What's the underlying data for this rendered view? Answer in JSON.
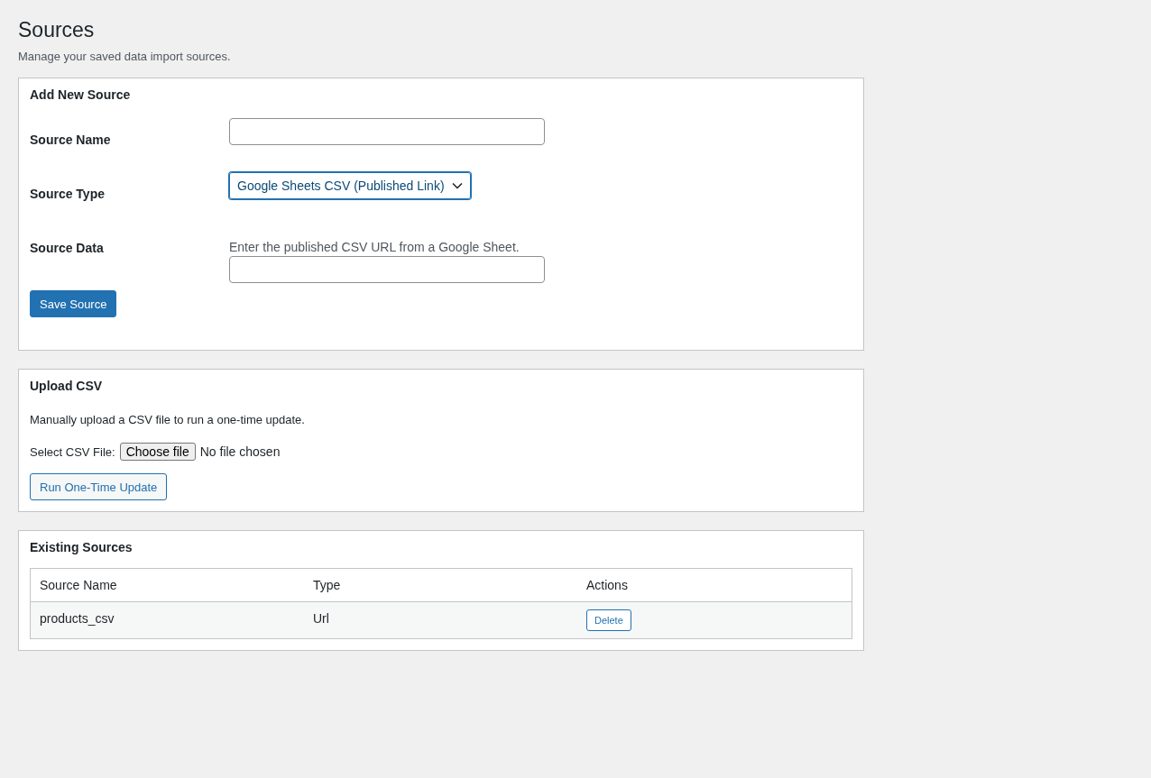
{
  "page": {
    "title": "Sources",
    "description": "Manage your saved data import sources."
  },
  "add_source": {
    "title": "Add New Source",
    "fields": [
      {
        "kind": "text",
        "label": "Source Name"
      },
      {
        "kind": "select",
        "label": "Source Type",
        "value": "Google Sheets CSV (Published Link)"
      },
      {
        "kind": "text",
        "label": "Source Data",
        "hint": "Enter the published CSV URL from a Google Sheet."
      }
    ],
    "button": "Save Source"
  },
  "upload": {
    "title": "Upload CSV",
    "description": "Manually upload a CSV file to run a one-time update.",
    "file_label": "Select CSV File:",
    "file_button": "Choose file",
    "file_status": "No file chosen",
    "button": "Run One-Time Update"
  },
  "existing": {
    "title": "Existing Sources",
    "columns": [
      "Source Name",
      "Type",
      "Actions"
    ],
    "rows": [
      {
        "cells": [
          "products_csv",
          "Url"
        ],
        "action": "Delete"
      }
    ]
  }
}
